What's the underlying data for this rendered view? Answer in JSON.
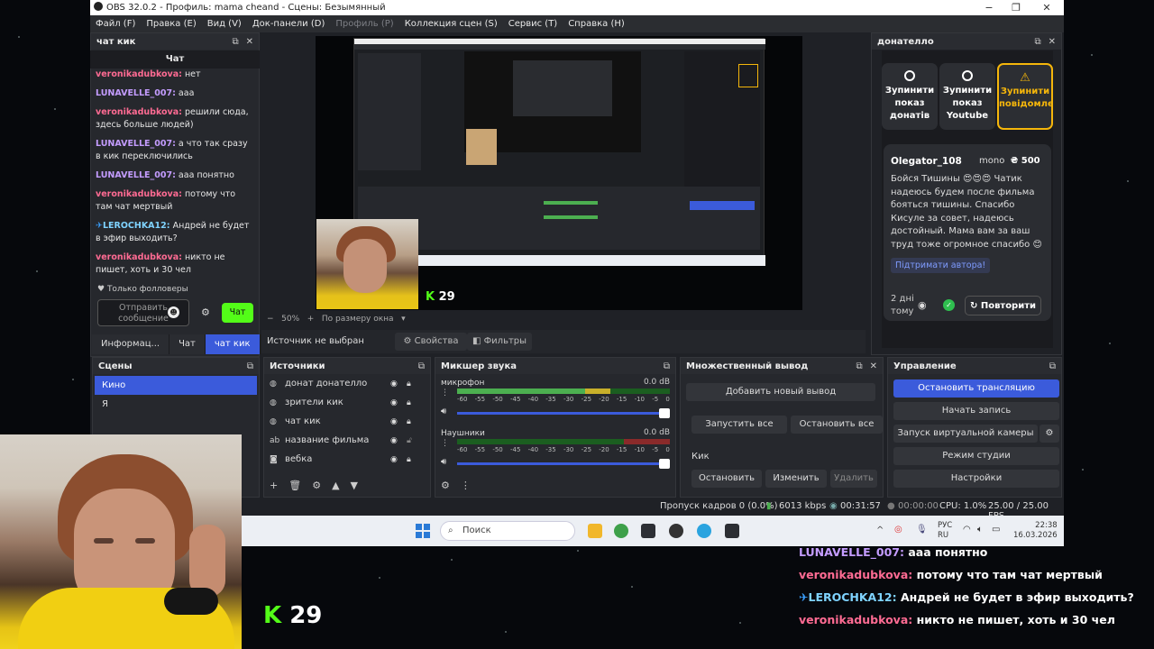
{
  "titlebar": {
    "title": "OBS 32.0.2 - Профиль: mama cheand - Сцены: Безымянный",
    "minimize": "−",
    "maximize": "❐",
    "close": "✕"
  },
  "menu": [
    {
      "label": "Файл (F)",
      "enabled": true
    },
    {
      "label": "Правка (E)",
      "enabled": true
    },
    {
      "label": "Вид (V)",
      "enabled": true
    },
    {
      "label": "Док-панели (D)",
      "enabled": true
    },
    {
      "label": "Профиль (P)",
      "enabled": false
    },
    {
      "label": "Коллекция сцен (S)",
      "enabled": true
    },
    {
      "label": "Сервис (T)",
      "enabled": true
    },
    {
      "label": "Справка (H)",
      "enabled": true
    }
  ],
  "chat_dock": {
    "title": "чат кик",
    "header": "Чат",
    "messages": [
      {
        "user": "veronikadubkova:",
        "text": " нет",
        "color": "#ff6b93",
        "badge": ""
      },
      {
        "user": "LUNAVELLE_007:",
        "text": " ааа",
        "color": "#c49cff",
        "badge": ""
      },
      {
        "user": "veronikadubkova:",
        "text": " решили сюда, здесь больше людей)",
        "color": "#ff6b93",
        "badge": ""
      },
      {
        "user": "LUNAVELLE_007:",
        "text": " а что так сразу в кик переключились",
        "color": "#c49cff",
        "badge": ""
      },
      {
        "user": "LUNAVELLE_007:",
        "text": " ааа понятно",
        "color": "#c49cff",
        "badge": ""
      },
      {
        "user": "veronikadubkova:",
        "text": " потому что там чат мертвый",
        "color": "#ff6b93",
        "badge": ""
      },
      {
        "user": "LEROCHKA12:",
        "text": " Андрей не будет в эфир выходить?",
        "color": "#7fd3ff",
        "badge": "✈"
      },
      {
        "user": "veronikadubkova:",
        "text": " никто не пишет, хоть и 30 чел",
        "color": "#ff6b93",
        "badge": ""
      }
    ],
    "followers_only": "Только фолловеры",
    "send_placeholder": "Отправить сообщение",
    "chat_button": "Чат",
    "tabs": [
      "Информац...",
      "Чат",
      "чат кик"
    ],
    "active_tab": 2
  },
  "preview": {
    "zoom": "50%",
    "fit": "По размеру окна",
    "kick_viewers": "29",
    "no_source": "Источник не выбран",
    "properties": "Свойства",
    "filters": "Фильтры"
  },
  "donatello": {
    "title": "донателло",
    "buttons": [
      {
        "label": "Зупинити показ донатів"
      },
      {
        "label": "Зупинити показ Youtube"
      },
      {
        "label": "Зупинити повідомлення"
      }
    ],
    "donation": {
      "name": "Olegator_108",
      "method": "mono",
      "amount": "₴ 500",
      "text": "Бойся Тишины 😍😍😍 Чатик надеюсь будем после фильма бояться тишины. Спасибо Кисуле за совет, надеюсь достойный. Мама вам за ваш труд тоже огромное спасибо 😊",
      "support_link": "Підтримати автора!",
      "time_ago": "2 дні тому",
      "repeat": "Повторити"
    }
  },
  "scenes": {
    "title": "Сцены",
    "items": [
      "Кино",
      "Я"
    ],
    "selected": 0
  },
  "sources": {
    "title": "Источники",
    "items": [
      {
        "label": "донат донателло",
        "icon": "browser-icon"
      },
      {
        "label": "зрители кик",
        "icon": "browser-icon"
      },
      {
        "label": "чат кик",
        "icon": "browser-icon"
      },
      {
        "label": "название фильма",
        "icon": "text-icon"
      },
      {
        "label": "вебка",
        "icon": "camera-icon"
      }
    ]
  },
  "mixer": {
    "title": "Микшер звука",
    "channels": [
      {
        "name": "микрофон",
        "db": "0.0 dB",
        "level": 0.72
      },
      {
        "name": "Наушники",
        "db": "0.0 dB",
        "level": 0.0
      }
    ],
    "scale": [
      "-60",
      "-55",
      "-50",
      "-45",
      "-40",
      "-35",
      "-30",
      "-25",
      "-20",
      "-15",
      "-10",
      "-5",
      "0"
    ]
  },
  "multi_output": {
    "title": "Множественный вывод",
    "add": "Добавить новый вывод",
    "start_all": "Запустить все",
    "stop_all": "Остановить все",
    "target": "Кик",
    "stop": "Остановить",
    "edit": "Изменить",
    "delete": "Удалить"
  },
  "controls": {
    "title": "Управление",
    "buttons": [
      "Остановить трансляцию",
      "Начать запись",
      "Запуск виртуальной камеры",
      "Режим студии",
      "Настройки"
    ]
  },
  "status": {
    "dropped": "Пропуск кадров 0 (0.0%)",
    "bitrate": "6013 kbps",
    "live_time": "00:31:57",
    "rec_time": "00:00:00",
    "cpu": "CPU: 1.0%",
    "fps": "25.00 / 25.00 FPS"
  },
  "taskbar": {
    "search": "Поиск",
    "lang": "РУС",
    "lang2": "RU",
    "time": "22:38",
    "date": "16.03.2026"
  },
  "overlay_chat": [
    {
      "user": "LUNAVELLE_007:",
      "text": " ааа понятно",
      "color": "#c49cff",
      "badge": ""
    },
    {
      "user": "veronikadubkova:",
      "text": " потому что там чат мертвый",
      "color": "#ff6b93",
      "badge": ""
    },
    {
      "user": "LEROCHKA12:",
      "text": " Андрей не будет в эфир выходить?",
      "color": "#7fd3ff",
      "badge": "✈"
    },
    {
      "user": "veronikadubkova:",
      "text": " никто не пишет, хоть и 30 чел",
      "color": "#ff6b93",
      "badge": ""
    }
  ],
  "overlay_viewers": "29"
}
